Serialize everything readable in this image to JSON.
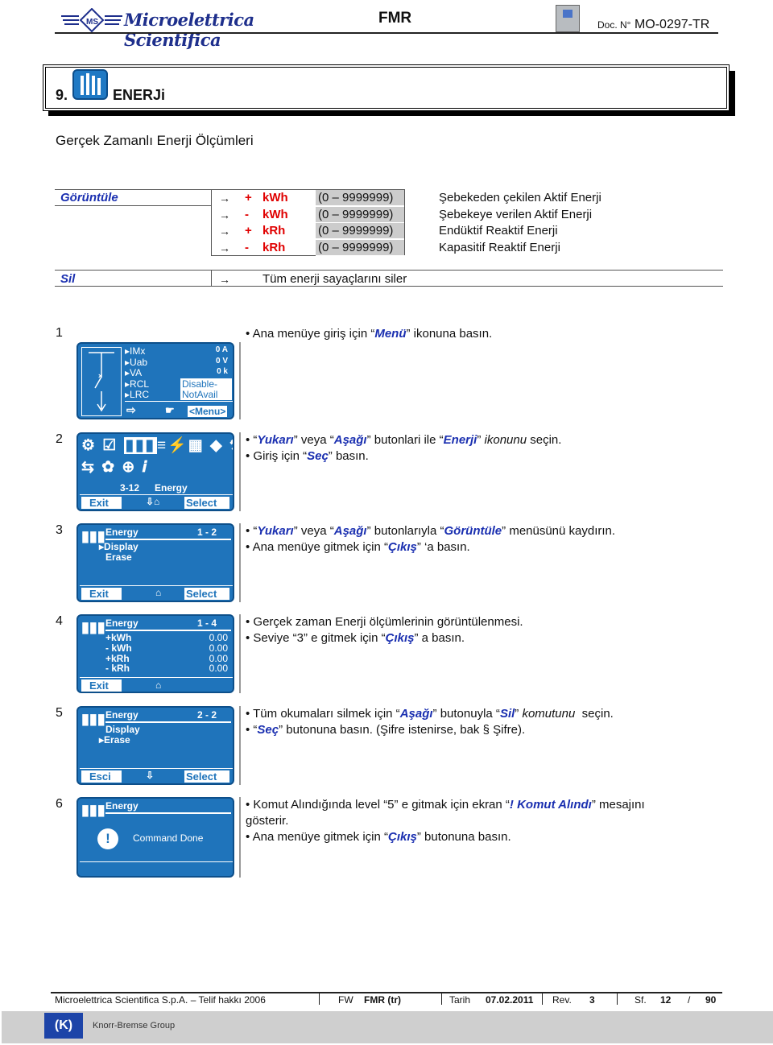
{
  "header": {
    "brand": "Microelettrica Scientifica",
    "title": "FMR",
    "doc_prefix": "Doc. N°",
    "doc_no": "MO-0297-TR"
  },
  "section": {
    "number": "9.",
    "title": "ENERJi",
    "icon": "energy-icon"
  },
  "subtitle": "Gerçek Zamanlı Enerji Ölçümleri",
  "table": {
    "display_label": "Görüntüle",
    "rows": [
      {
        "arrow": "→",
        "sign": "+",
        "unit": "kWh",
        "range": "(0 – 9999999)",
        "desc": "Şebekeden çekilen Aktif Enerji"
      },
      {
        "arrow": "→",
        "sign": "-",
        "unit": "kWh",
        "range": "(0 – 9999999)",
        "desc": "Şebekeye verilen Aktif Enerji"
      },
      {
        "arrow": "→",
        "sign": "+",
        "unit": "kRh",
        "range": "(0 – 9999999)",
        "desc": "Endüktif Reaktif Enerji"
      },
      {
        "arrow": "→",
        "sign": "-",
        "unit": "kRh",
        "range": "(0 – 9999999)",
        "desc": "Kapasitif Reaktif Enerji"
      }
    ],
    "erase_label": "Sil",
    "erase_arrow": "→",
    "erase_desc": "Tüm enerji sayaçlarını siler"
  },
  "steps": [
    {
      "num": "1",
      "lines": [
        [
          {
            "t": "• Ana menüye giriş için “"
          },
          {
            "t": "Menü",
            "s": "bb"
          },
          {
            "t": "” ikonuna basın."
          }
        ]
      ]
    },
    {
      "num": "2",
      "lines": [
        [
          {
            "t": "• “"
          },
          {
            "t": "Yukarı",
            "s": "bb"
          },
          {
            "t": "” veya “"
          },
          {
            "t": "Aşağı",
            "s": "bb"
          },
          {
            "t": "” butonlari ile “"
          },
          {
            "t": "Enerji",
            "s": "bb"
          },
          {
            "t": "” "
          },
          {
            "t": "ikonunu",
            "s": "it"
          },
          {
            "t": " seçin."
          }
        ],
        [
          {
            "t": "• Giriş için “"
          },
          {
            "t": "Seç",
            "s": "bb"
          },
          {
            "t": "” basın."
          }
        ]
      ]
    },
    {
      "num": "3",
      "lines": [
        [
          {
            "t": "• “"
          },
          {
            "t": "Yukarı",
            "s": "bb"
          },
          {
            "t": "” veya “"
          },
          {
            "t": "Aşağı",
            "s": "bb"
          },
          {
            "t": "” butonlarıyla “"
          },
          {
            "t": "Görüntüle",
            "s": "bb"
          },
          {
            "t": "” menüsünü kaydırın."
          }
        ],
        [
          {
            "t": "• Ana menüye gitmek için “"
          },
          {
            "t": "Çıkış",
            "s": "bb"
          },
          {
            "t": "” ‘a basın."
          }
        ]
      ]
    },
    {
      "num": "4",
      "lines": [
        [
          {
            "t": "• Gerçek zaman Enerji ölçümlerinin görüntülenmesi."
          }
        ],
        [
          {
            "t": "• Seviye “3” e gitmek için “"
          },
          {
            "t": "Çıkış",
            "s": "bb"
          },
          {
            "t": "” a basın."
          }
        ]
      ]
    },
    {
      "num": "5",
      "lines": [
        [
          {
            "t": "• Tüm okumaları silmek için “"
          },
          {
            "t": "Aşağı",
            "s": "bb"
          },
          {
            "t": "” butonuyla “"
          },
          {
            "t": "Sil",
            "s": "bb"
          },
          {
            "t": "” "
          },
          {
            "t": "komutunu",
            "s": "it"
          },
          {
            "t": "  seçin."
          }
        ],
        [
          {
            "t": "• “"
          },
          {
            "t": "Seç",
            "s": "bb"
          },
          {
            "t": "” butonuna basın. (Şifre istenirse, bak § Şifre)."
          }
        ]
      ]
    },
    {
      "num": "6",
      "lines": [
        [
          {
            "t": "• Komut Alındığında level “5” e gitmak için ekran “"
          },
          {
            "t": "! Komut Alındı",
            "s": "bb"
          },
          {
            "t": "” mesajını"
          }
        ],
        [
          {
            "t": "gösterir."
          }
        ],
        [
          {
            "t": "• Ana menüye gitmek için “"
          },
          {
            "t": "Çıkış",
            "s": "bb"
          },
          {
            "t": "” butonuna basın."
          }
        ]
      ]
    }
  ],
  "screens": {
    "s1": {
      "rows": [
        {
          "k": "IMx",
          "v": "0 A"
        },
        {
          "k": "Uab",
          "v": "0 V"
        },
        {
          "k": "VA",
          "v": "0 k"
        },
        {
          "k": "RCL",
          "v": "Disable-"
        },
        {
          "k": "LRC",
          "v": "NotAvail"
        }
      ],
      "menu": "<Menu>"
    },
    "s2": {
      "caption_num": "3-12",
      "caption": "Energy",
      "exit": "Exit",
      "select": "Select"
    },
    "s3": {
      "title": "Energy",
      "page": "1 - 2",
      "items": [
        "Display",
        "Erase"
      ],
      "exit": "Exit",
      "select": "Select"
    },
    "s4": {
      "title": "Energy",
      "page": "1 - 4",
      "rows": [
        {
          "k": "+kWh",
          "v": "0.00"
        },
        {
          "k": "- kWh",
          "v": "0.00"
        },
        {
          "k": "+kRh",
          "v": "0.00"
        },
        {
          "k": "- kRh",
          "v": "0.00"
        }
      ],
      "exit": "Exit"
    },
    "s5": {
      "title": "Energy",
      "page": "2 - 2",
      "items": [
        "Display",
        "Erase"
      ],
      "exit": "Esci",
      "select": "Select"
    },
    "s6": {
      "title": "Energy",
      "message": "Command Done",
      "alert": "!"
    }
  },
  "footer": {
    "company": "Microelettrica Scientifica S.p.A. – Telif hakkı 2006",
    "fw_label": "FW",
    "fw": "FMR (tr)",
    "date_label": "Tarih",
    "date": "07.02.2011",
    "rev_label": "Rev.",
    "rev": "3",
    "page_label": "Sf.",
    "page": "12",
    "page_sep": "/",
    "pages": "90",
    "group": "Knorr-Bremse Group",
    "group_logo": "K"
  }
}
